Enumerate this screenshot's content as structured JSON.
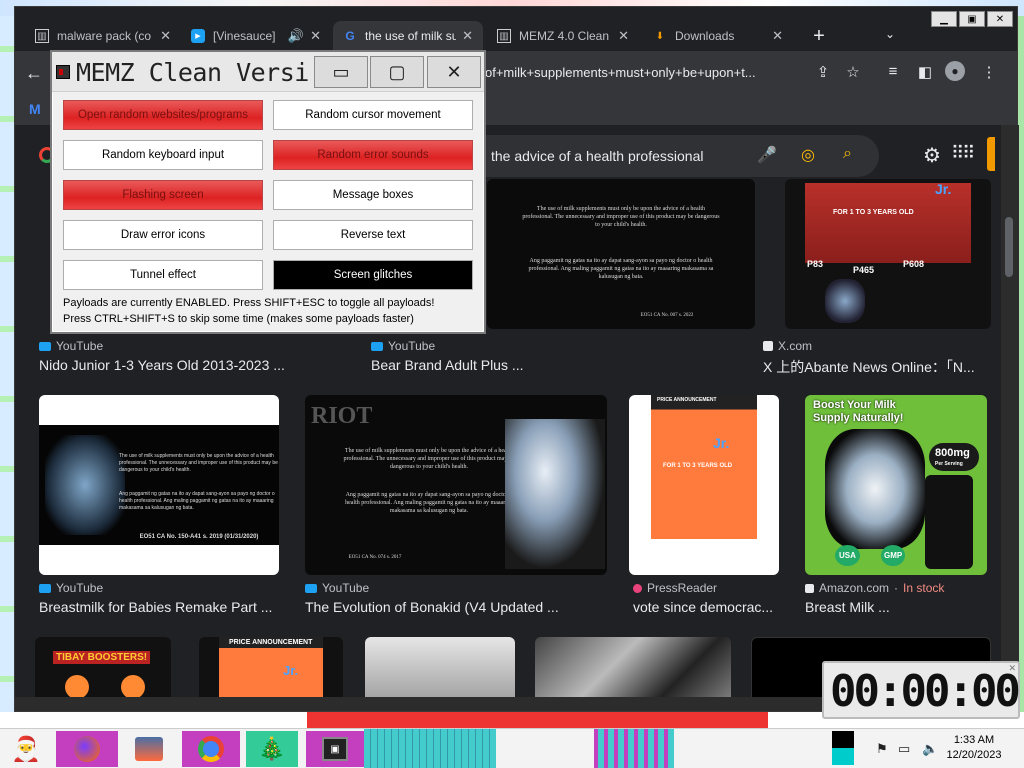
{
  "browser": {
    "tabs": [
      {
        "label": "malware pack (co",
        "close": "✕"
      },
      {
        "label": "[Vinesauce]",
        "close": "✕"
      },
      {
        "label": "the use of milk su",
        "close": "✕"
      },
      {
        "label": "MEMZ 4.0 Clean",
        "close": "✕"
      },
      {
        "label": "Downloads",
        "close": "✕"
      }
    ],
    "new_tab": "+",
    "url": "of+milk+supplements+must+only+be+upon+t..."
  },
  "search": {
    "query": "the advice of a health professional"
  },
  "results": [
    {
      "source": "YouTube",
      "title": "Nido Junior 1-3 Years Old 2013-2023 ..."
    },
    {
      "source": "YouTube",
      "title": "Bear Brand Adult Plus ..."
    },
    {
      "source": "X.com",
      "title": "X 上的Abante News Online：「N..."
    },
    {
      "source": "YouTube",
      "title": "Breastmilk for Babies Remake Part ..."
    },
    {
      "source": "YouTube",
      "title": "The Evolution of Bonakid (V4 Updated ..."
    },
    {
      "source": "PressReader",
      "title": "vote since democrac..."
    },
    {
      "source": "Amazon.com",
      "stock": "In stock",
      "title": "Breast Milk ..."
    }
  ],
  "thumb_text": {
    "disclaimer_en": "The use of milk supplements must only be upon the advice of a health professional. The unnecessary and improper use of this product may be dangerous to your child's health.",
    "disclaimer_tl": "Ang paggamit ng gatas na ito ay dapat sang-ayon sa payo ng doctor o health professional. Ang maling paggamit ng gatas na ito ay maaaring makasama sa kalusugan ng bata.",
    "eo_1": "EO51 CA No. 007 s. 2022",
    "eo_2": "EO51 CA No. 150-A41 s. 2019 (01/31/2020)",
    "eo_3": "EO51 CA No. 074 s. 2017",
    "for_age": "FOR 1 TO 3 YEARS OLD",
    "prices": [
      "P83",
      "P465",
      "P608"
    ],
    "price_announcement": "PRICE ANNOUNCEMENT",
    "jr": "Jr.",
    "boost": "Boost Your Milk Supply Naturally!",
    "mg": "800mg",
    "per_serving": "Per Serving",
    "usa": "USA",
    "gmp": "GMP",
    "tibay": "TIBAY BOOSTERS!",
    "riot": "RIOT"
  },
  "memz": {
    "title": "MEMZ Clean Versi...",
    "payloads": [
      {
        "label": "Open random websites/programs",
        "state": "on"
      },
      {
        "label": "Random cursor movement",
        "state": "off"
      },
      {
        "label": "Random keyboard input",
        "state": "off"
      },
      {
        "label": "Random error sounds",
        "state": "on"
      },
      {
        "label": "Flashing screen",
        "state": "on"
      },
      {
        "label": "Message boxes",
        "state": "off"
      },
      {
        "label": "Draw error icons",
        "state": "off"
      },
      {
        "label": "Reverse text",
        "state": "off"
      },
      {
        "label": "Tunnel effect",
        "state": "off"
      },
      {
        "label": "Screen glitches",
        "state": "black"
      }
    ],
    "info_line1": "Payloads are currently ENABLED. Press SHIFT+ESC to toggle all payloads!",
    "info_line2": "Press CTRL+SHIFT+S to skip some time (makes some payloads faster)"
  },
  "timer": {
    "value": "00:00:00"
  },
  "taskbar": {
    "time": "1:33 AM",
    "date": "12/20/2023"
  }
}
